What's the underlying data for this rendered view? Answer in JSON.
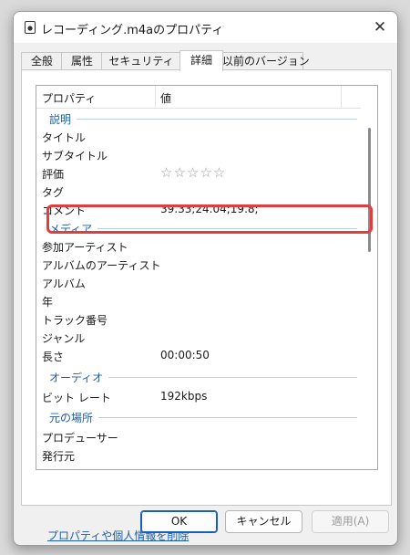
{
  "window": {
    "title": "レコーディング.m4aのプロパティ"
  },
  "tabs": [
    {
      "label": "全般"
    },
    {
      "label": "属性"
    },
    {
      "label": "セキュリティ"
    },
    {
      "label": "詳細"
    },
    {
      "label": "以前のバージョン"
    }
  ],
  "list": {
    "header": {
      "name": "プロパティ",
      "value": "値"
    },
    "groups": {
      "description": "説明",
      "media": "メディア",
      "audio": "オーディオ",
      "origin": "元の場所"
    },
    "rows": [
      {
        "name": "タイトル",
        "value": ""
      },
      {
        "name": "サブタイトル",
        "value": ""
      },
      {
        "name": "評価",
        "value": "☆☆☆☆☆"
      },
      {
        "name": "タグ",
        "value": ""
      },
      {
        "name": "コメント",
        "value": "39.33;24.04;19.8;"
      },
      {
        "name": "参加アーティスト",
        "value": ""
      },
      {
        "name": "アルバムのアーティスト",
        "value": ""
      },
      {
        "name": "アルバム",
        "value": ""
      },
      {
        "name": "年",
        "value": ""
      },
      {
        "name": "トラック番号",
        "value": ""
      },
      {
        "name": "ジャンル",
        "value": ""
      },
      {
        "name": "長さ",
        "value": "00:00:50"
      },
      {
        "name": "ビット レート",
        "value": "192kbps"
      },
      {
        "name": "プロデューサー",
        "value": ""
      },
      {
        "name": "発行元",
        "value": ""
      }
    ]
  },
  "link": "プロパティや個人情報を削除",
  "buttons": {
    "ok": "OK",
    "cancel": "キャンセル",
    "apply": "適用(A)"
  },
  "colors": {
    "highlight": "#e23c3c",
    "group": "#1e5ea8",
    "link": "#1a5fb4"
  }
}
